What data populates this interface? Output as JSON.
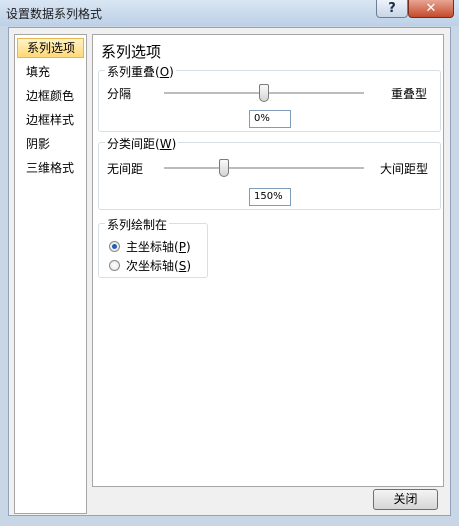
{
  "window": {
    "title": "设置数据系列格式",
    "help_glyph": "?",
    "close_glyph": "✕"
  },
  "nav": {
    "items": [
      {
        "label": "系列选项",
        "selected": true
      },
      {
        "label": "填充"
      },
      {
        "label": "边框颜色"
      },
      {
        "label": "边框样式"
      },
      {
        "label": "阴影"
      },
      {
        "label": "三维格式"
      }
    ]
  },
  "panel": {
    "title": "系列选项",
    "overlap": {
      "label": "系列重叠",
      "hotkey": "O",
      "left_label": "分隔",
      "right_label": "重叠型",
      "value": "0%",
      "position": 0.5
    },
    "gap": {
      "label": "分类间距",
      "hotkey": "W",
      "left_label": "无间距",
      "right_label": "大间距型",
      "value": "150%",
      "position": 0.3
    },
    "plot_on": {
      "label": "系列绘制在",
      "options": [
        {
          "label": "主坐标轴",
          "hotkey": "P",
          "checked": true
        },
        {
          "label": "次坐标轴",
          "hotkey": "S",
          "checked": false
        }
      ]
    }
  },
  "footer": {
    "close_label": "关闭"
  }
}
